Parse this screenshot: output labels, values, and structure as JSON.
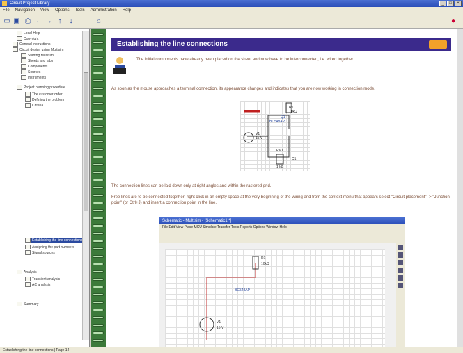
{
  "window": {
    "title": "Circuit Project Library"
  },
  "menu": [
    "File",
    "Navigation",
    "View",
    "Options",
    "Tools",
    "Administration",
    "Help"
  ],
  "content": {
    "heading": "Establishing the line connections",
    "intro": "The initial components have already been placed on the sheet and now have to be interconnected, i.e. wired together.",
    "para1": "As soon as the mouse approaches a terminal connection, its appearance changes and indicates that you are now working in connection mode.",
    "para2": "The connection lines can be laid down only at right angles and within the rastered grid.",
    "para3": "Free lines are to be connected together; right click in an empty space at the very beginning of the wiring and from the context menu that appears select \"Circuit placement\" -> \"Junction point\" (or Ctrl+J) and insert a connection point in the line."
  },
  "circuit": {
    "labels": [
      "R1",
      "10kΩ",
      "BC548AP",
      "Q1",
      "V1",
      "15 V",
      "RV1",
      "C1",
      "1 kΩ"
    ]
  },
  "screenshot": {
    "title": "Schematic - Multisim - [Schematic1 *]",
    "menu": "File  Edit  View  Place  MCU  Simulate  Transfer  Tools  Reports  Options  Window  Help"
  },
  "tree": {
    "items": [
      "Local Help",
      "Copyright",
      "General instructions",
      "Circuit design using Multisim",
      "Starting Multisim",
      "Sheets and tabs",
      "Components",
      "Sources",
      "Instruments",
      "Project planning procedure",
      "The customer order",
      "Defining the problem",
      "Criteria",
      "Establishing the line connections",
      "Assigning the part numbers",
      "Signal sources",
      "Analysis",
      "Transient analysis",
      "AC analysis",
      "Summary"
    ]
  },
  "status": "Establishing the line connections  |  Page 14"
}
